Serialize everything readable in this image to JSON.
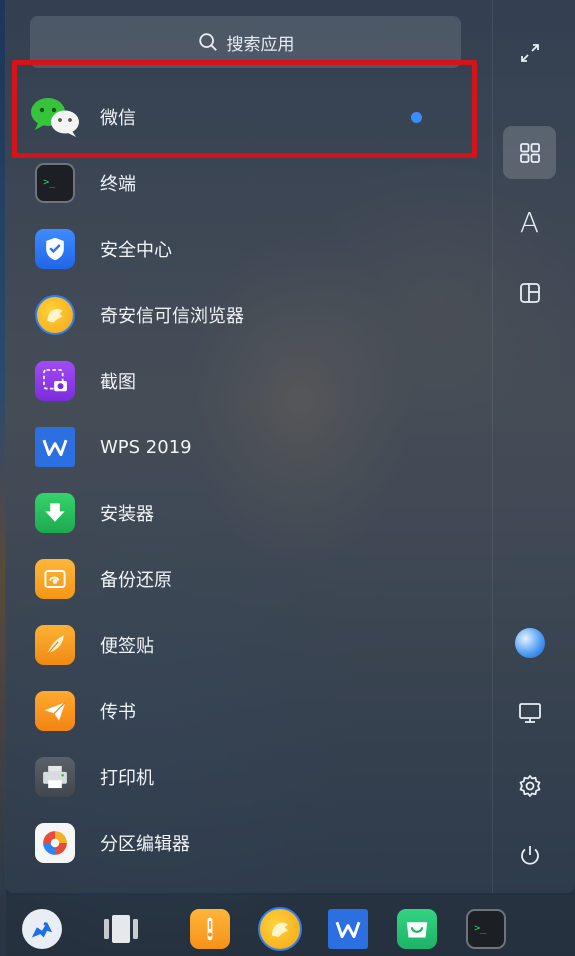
{
  "search": {
    "placeholder": "搜索应用",
    "icon": "search-icon"
  },
  "apps": [
    {
      "label": "微信",
      "icon": "wechat-icon",
      "has_new_indicator": true,
      "highlighted": true
    },
    {
      "label": "终端",
      "icon": "terminal-icon"
    },
    {
      "label": "安全中心",
      "icon": "security-center-icon"
    },
    {
      "label": "奇安信可信浏览器",
      "icon": "qianxin-browser-icon"
    },
    {
      "label": "截图",
      "icon": "screenshot-icon"
    },
    {
      "label": "WPS 2019",
      "icon": "wps-icon"
    },
    {
      "label": "安装器",
      "icon": "installer-icon"
    },
    {
      "label": "备份还原",
      "icon": "backup-restore-icon"
    },
    {
      "label": "便签贴",
      "icon": "sticky-notes-icon"
    },
    {
      "label": "传书",
      "icon": "file-transfer-icon"
    },
    {
      "label": "打印机",
      "icon": "printer-icon"
    },
    {
      "label": "分区编辑器",
      "icon": "partition-editor-icon"
    }
  ],
  "sidebar": {
    "top": [
      "fullscreen-icon",
      "grid-view-icon",
      "letter-sort-icon",
      "category-view-icon"
    ],
    "active": "grid-view-icon",
    "letter_sort_glyph": "A",
    "bottom": [
      "user-avatar-icon",
      "computer-icon",
      "settings-icon",
      "power-icon"
    ]
  },
  "dock": [
    "start-menu-icon",
    "multitask-view-icon",
    "file-manager-icon",
    "qianxin-browser-icon",
    "wps-icon",
    "app-store-icon",
    "terminal-icon"
  ],
  "colors": {
    "highlight_box": "#d4141b",
    "new_dot": "#3a8dff"
  }
}
